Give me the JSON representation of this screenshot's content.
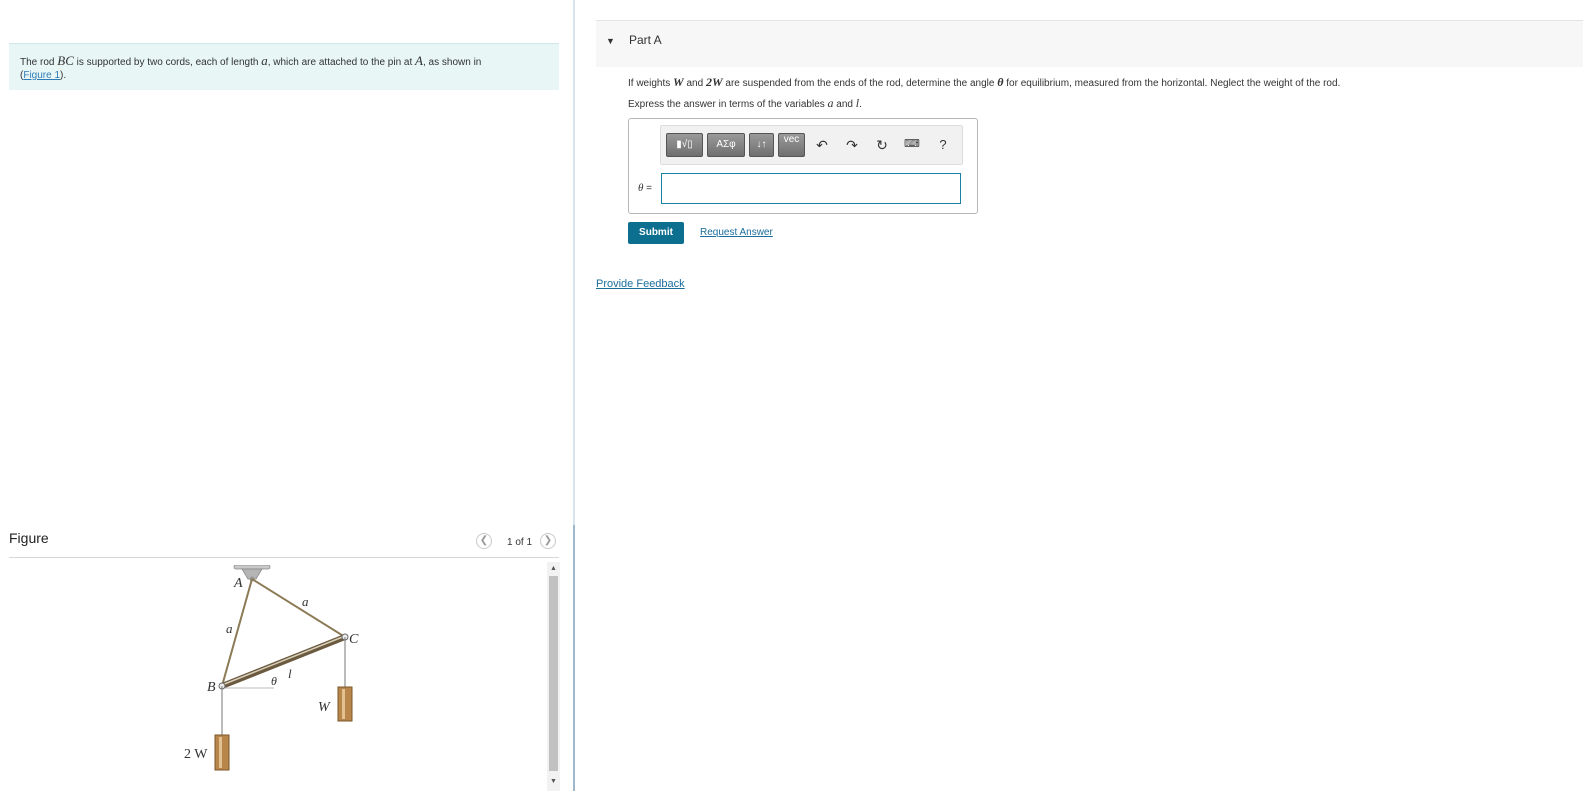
{
  "intro": {
    "p1": "The rod ",
    "var_BC": "BC",
    "p2": " is supported by two cords, each of length ",
    "var_a": "a",
    "p3": ", which are attached to the pin at ",
    "var_A": "A",
    "p4": ", as shown in",
    "link_open": "(",
    "link_text": "Figure 1",
    "link_close": ")."
  },
  "figure": {
    "heading": "Figure",
    "pager": "1 of 1",
    "prev_icon": "chevron-left-icon",
    "next_icon": "chevron-right-icon",
    "labels": {
      "A": "A",
      "B": "B",
      "C": "C",
      "a_left": "a",
      "a_right": "a",
      "theta": "θ",
      "l": "l",
      "W": "W",
      "two_W": "2 W"
    }
  },
  "part": {
    "title": "Part A",
    "caret_icon": "caret-down-icon",
    "question": {
      "p1": "If weights ",
      "W": "W",
      "p2": " and ",
      "twoW": "2W",
      "p3": " are suspended from the ends of the rod, determine the angle ",
      "theta": "θ",
      "p4": " for equilibrium, measured from the horizontal. Neglect the weight of the rod."
    },
    "express": {
      "p1": "Express the answer in terms of the variables ",
      "a": "a",
      "p2": " and ",
      "l": "l",
      "p3": "."
    },
    "toolbar": {
      "templates_label": "▮√▯",
      "greek_label": "ΑΣφ",
      "arrows_label": "↓↑",
      "vec_label": "vec",
      "undo_icon": "undo-icon",
      "redo_icon": "redo-icon",
      "reset_icon": "reset-icon",
      "keyboard_icon": "keyboard-icon",
      "help_label": "?"
    },
    "answer": {
      "variable": "θ",
      "equals": " =",
      "value": ""
    },
    "submit_label": "Submit",
    "request_label": "Request Answer"
  },
  "feedback_label": "Provide Feedback",
  "colors": {
    "accent": "#0d6f8f",
    "link": "#1b6d9c",
    "intro_bg": "#e8f6f6",
    "input_border": "#1b7fa7"
  }
}
